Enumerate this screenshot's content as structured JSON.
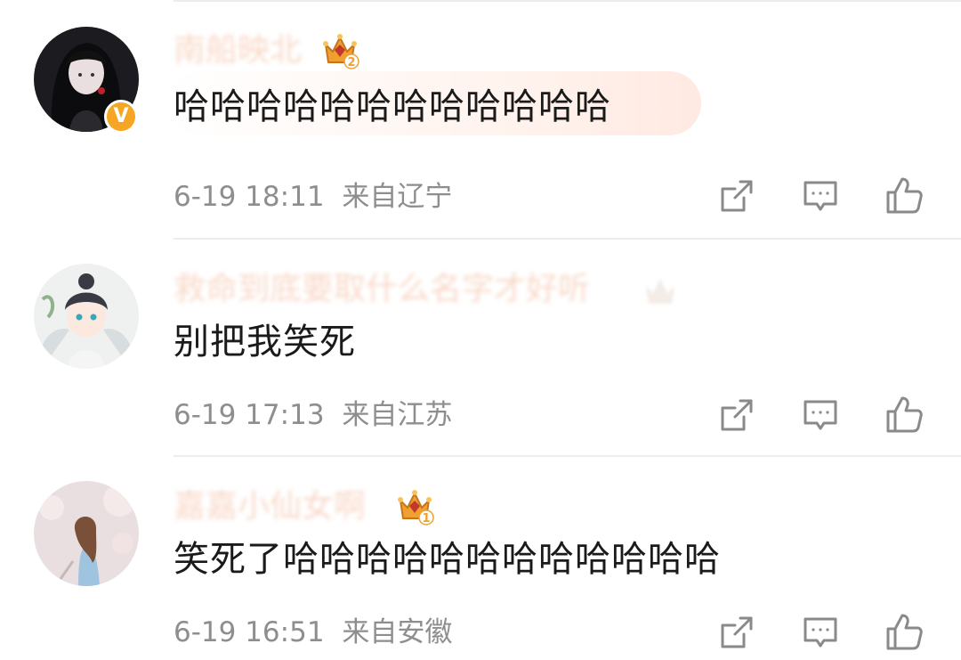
{
  "comments": [
    {
      "username": "南船映北",
      "verified_badge": "V",
      "crown_level": "2",
      "content": "哈哈哈哈哈哈哈哈哈哈哈哈",
      "time": "6-19 18:11",
      "location": "来自辽宁",
      "highlighted": true
    },
    {
      "username": "救命到底要取什么名字才好听",
      "crown_level": "",
      "content": "别把我笑死",
      "time": "6-19 17:13",
      "location": "来自江苏",
      "highlighted": false
    },
    {
      "username": "嘉嘉小仙女啊",
      "crown_level": "1",
      "content": "笑死了哈哈哈哈哈哈哈哈哈哈哈哈",
      "time": "6-19 16:51",
      "location": "来自安徽",
      "highlighted": false
    }
  ],
  "icons": {
    "share": "share-icon",
    "reply": "comment-icon",
    "like": "thumbs-up-icon"
  },
  "colors": {
    "username": "#f3b89a",
    "content": "#1a1a1a",
    "meta": "#8e8e8e",
    "verified": "#f5a623",
    "crown": "#f0a030",
    "icon": "#8a8a8a"
  }
}
